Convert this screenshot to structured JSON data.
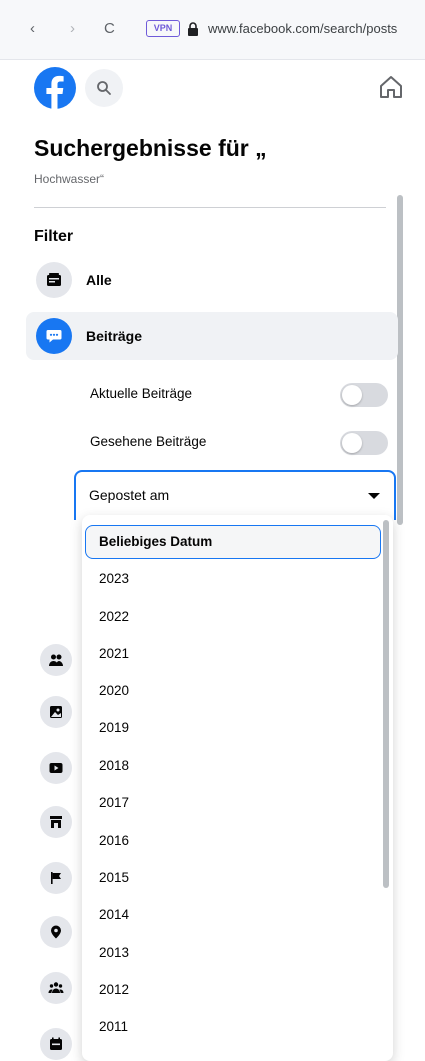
{
  "browser": {
    "back_glyph": "‹",
    "forward_glyph": "›",
    "reload_glyph": "C",
    "vpn_label": "VPN",
    "url": "www.facebook.com/search/posts"
  },
  "header": {
    "logo": "facebook-logo",
    "search_icon": "search-icon",
    "home_icon": "home-icon"
  },
  "sidebar": {
    "title": "Suchergebnisse für „",
    "query": "Hochwasser“",
    "filter_heading": "Filter",
    "filters": [
      {
        "label": "Alle",
        "icon": "feed-icon",
        "active": false
      },
      {
        "label": "Beiträge",
        "icon": "posts-icon",
        "active": true
      }
    ],
    "toggles": [
      {
        "label": "Aktuelle Beiträge",
        "on": false
      },
      {
        "label": "Gesehene Beiträge",
        "on": false
      }
    ],
    "date_select": {
      "label": "Gepostet am",
      "options": [
        "Beliebiges Datum",
        "2023",
        "2022",
        "2021",
        "2020",
        "2019",
        "2018",
        "2017",
        "2016",
        "2015",
        "2014",
        "2013",
        "2012",
        "2011"
      ],
      "selected": "Beliebiges Datum"
    },
    "more_filter_icons": [
      "people-icon",
      "photos-icon",
      "videos-icon",
      "marketplace-icon",
      "pages-icon",
      "places-icon",
      "groups-icon",
      "events-icon"
    ]
  },
  "colors": {
    "facebook_blue": "#1877f2",
    "active_row": "#f0f2f5",
    "toggle_off": "#d8dadf"
  }
}
